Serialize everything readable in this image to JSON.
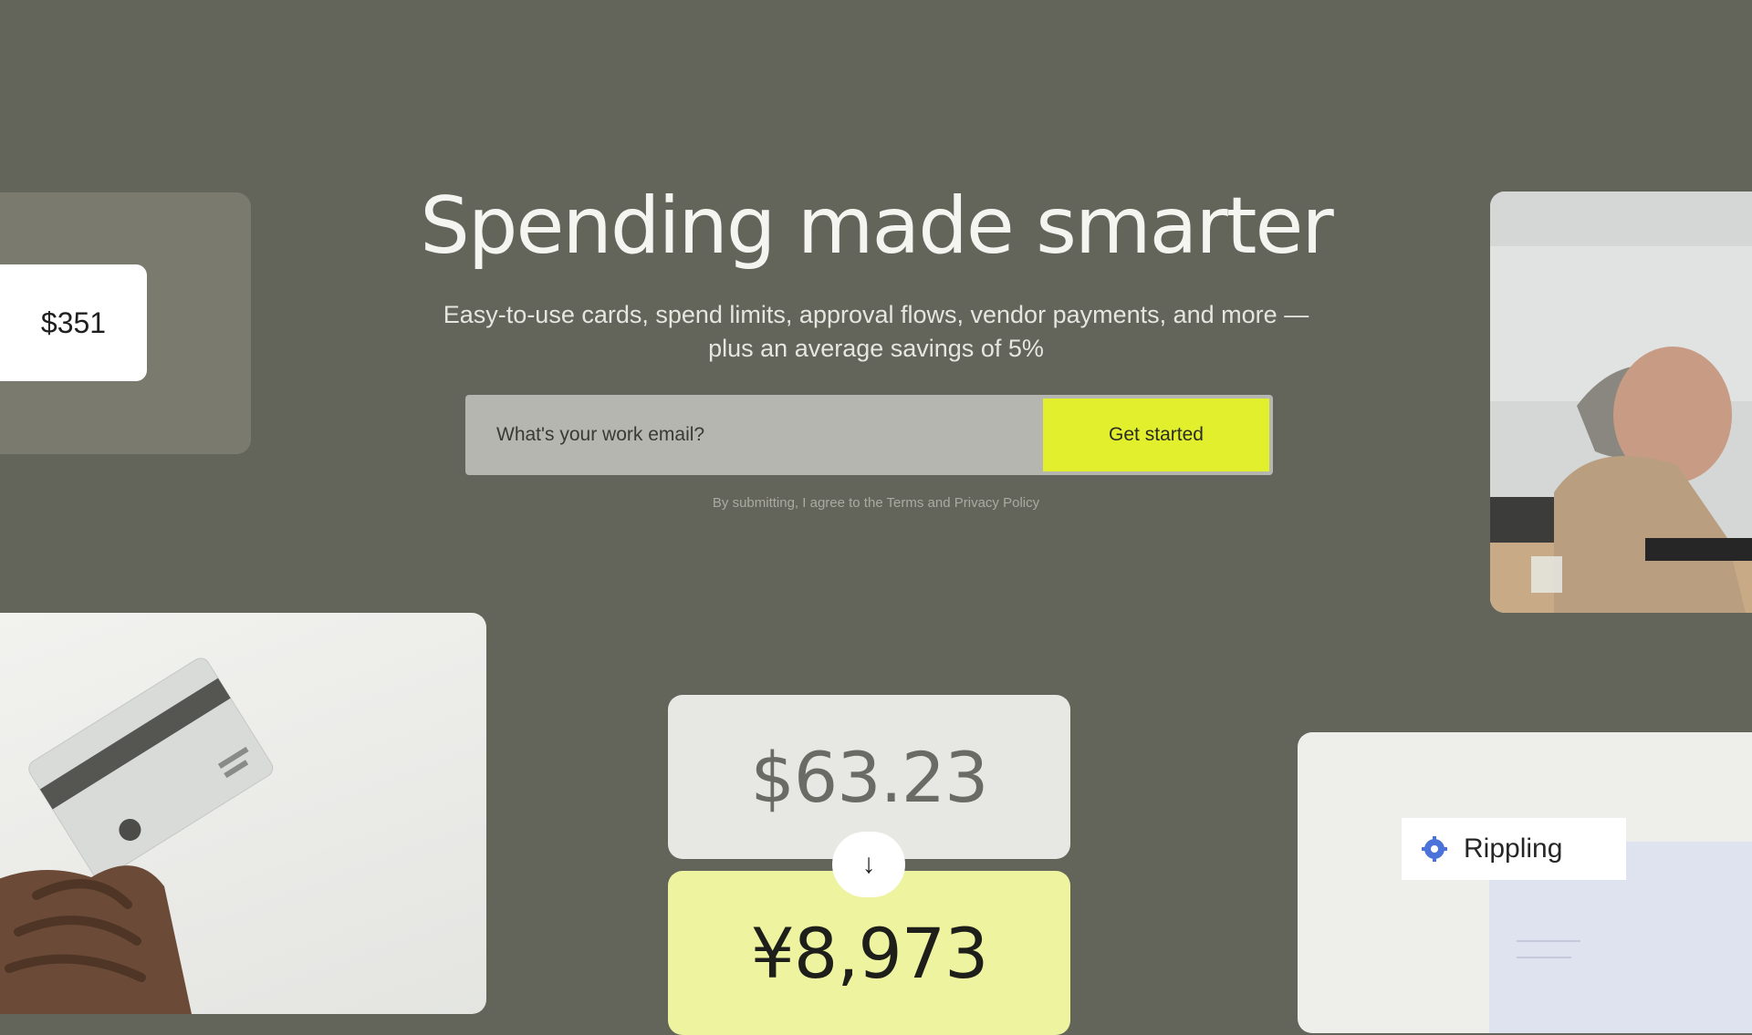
{
  "hero": {
    "title": "Spending made smarter",
    "subtitle": "Easy-to-use cards, spend limits, approval flows, vendor payments, and more — plus an average savings of 5%"
  },
  "signup": {
    "email_placeholder": "What's your work email?",
    "cta_label": "Get started",
    "disclaimer": "By submitting, I agree to the Terms and Privacy Policy"
  },
  "cards": {
    "top_left_amount": "$351",
    "convert_from": "$63.23",
    "convert_to": "¥8,973",
    "convert_arrow": "↓",
    "integration_label": "Rippling"
  },
  "colors": {
    "background": "#63645a",
    "accent": "#e2ef2d",
    "converted_card": "#eef3a0",
    "integration_icon": "#4a72d8"
  }
}
